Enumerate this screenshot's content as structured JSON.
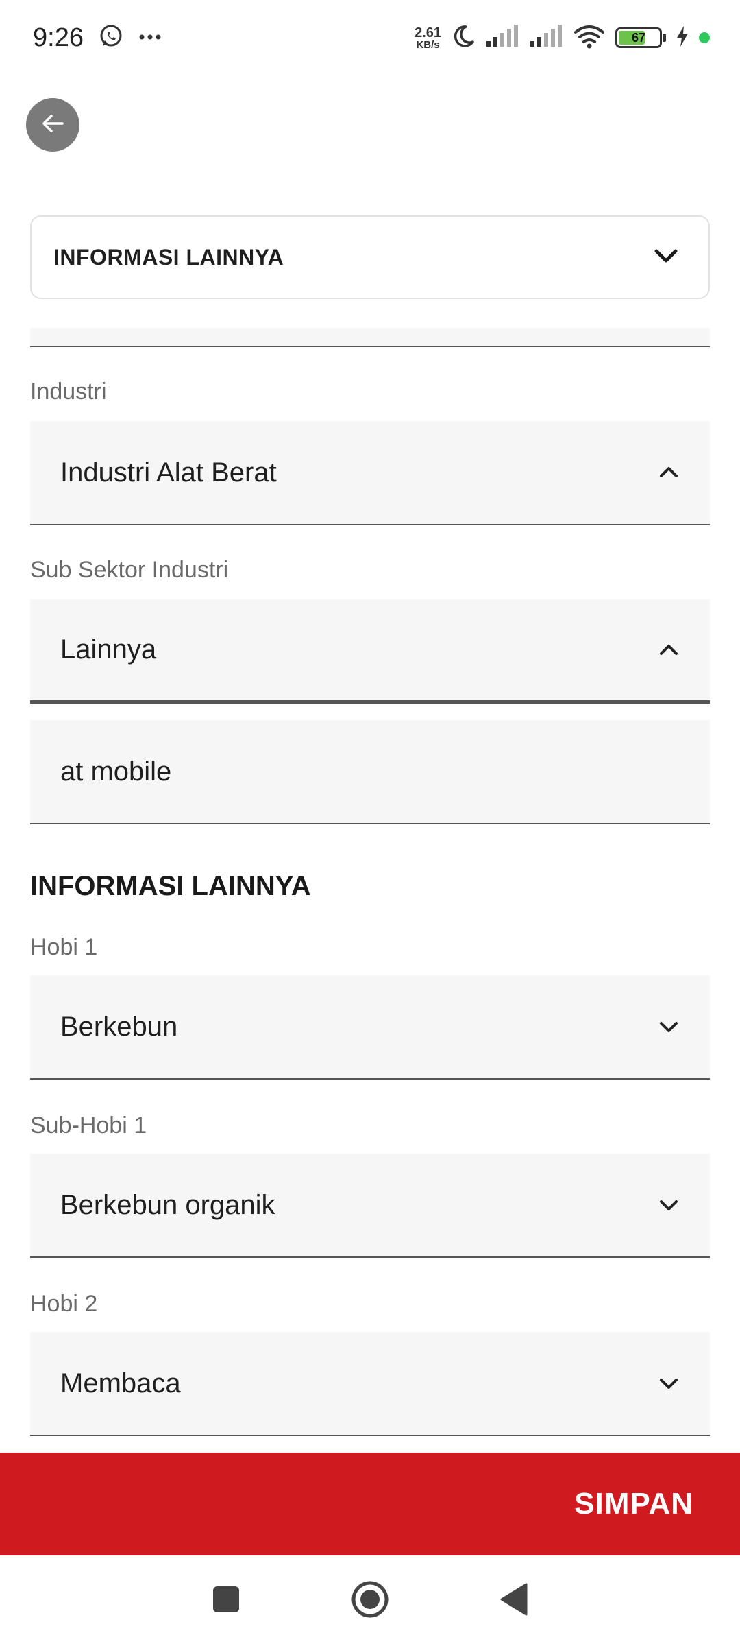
{
  "status_bar": {
    "time": "9:26",
    "net_speed_value": "2.61",
    "net_speed_unit": "KB/s",
    "battery_level": "67",
    "icons": [
      "whatsapp-icon",
      "more-dots-icon",
      "moon-icon",
      "signal-icon",
      "signal-icon",
      "wifi-icon",
      "battery-icon",
      "charging-icon"
    ]
  },
  "header": {
    "back_icon": "arrow-left-icon"
  },
  "section_selector": {
    "label": "INFORMASI LAINNYA",
    "icon": "chevron-down-icon"
  },
  "form": {
    "industri": {
      "label": "Industri",
      "value": "Industri Alat Berat",
      "icon": "chevron-up-icon"
    },
    "sub_sektor": {
      "label": "Sub Sektor Industri",
      "value": "Lainnya",
      "icon": "chevron-up-icon"
    },
    "sub_sektor_other": {
      "value": "at mobile"
    },
    "section_title": "INFORMASI LAINNYA",
    "hobi1": {
      "label": "Hobi 1",
      "value": "Berkebun",
      "icon": "chevron-down-icon"
    },
    "sub_hobi1": {
      "label": "Sub-Hobi 1",
      "value": "Berkebun organik",
      "icon": "chevron-down-icon"
    },
    "hobi2": {
      "label": "Hobi 2",
      "value": "Membaca",
      "icon": "chevron-down-icon"
    }
  },
  "footer": {
    "save_label": "SIMPAN"
  },
  "colors": {
    "accent": "#cf1a1f",
    "field_bg": "#f6f6f6",
    "battery_green": "#6cc24a"
  }
}
